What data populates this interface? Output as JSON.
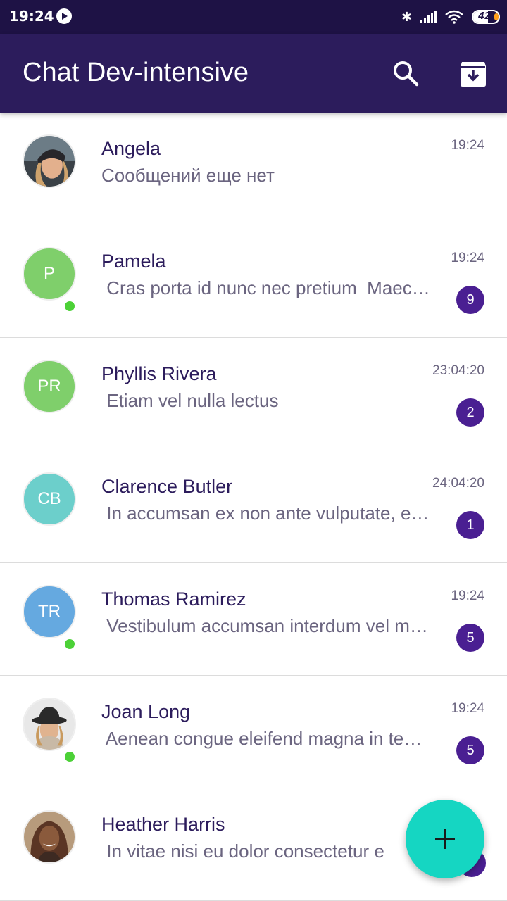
{
  "status_bar": {
    "time": "19:24",
    "battery": "42"
  },
  "app_bar": {
    "title": "Chat Dev-intensive"
  },
  "colors": {
    "primary": "#2c1c5c",
    "status_bar": "#1e1245",
    "accent": "#15d6c2",
    "badge": "#4a1f92",
    "online": "#4cd137"
  },
  "chats": [
    {
      "name": "Angela",
      "message": "Сообщений еще нет",
      "time": "19:24"
    },
    {
      "name": "Pamela",
      "message": " Cras porta id nunc nec pretium  Maecenas",
      "time": "19:24",
      "unread": "9",
      "initials": "P",
      "avatar_color": "#7fcf6b"
    },
    {
      "name": "Phyllis Rivera",
      "message": " Etiam vel nulla lectus",
      "time": "23:04:20",
      "unread": "2",
      "initials": "PR",
      "avatar_color": "#7fcf6b"
    },
    {
      "name": "Clarence Butler",
      "message": " In accumsan ex non ante vulputate, eget",
      "time": "24:04:20",
      "unread": "1",
      "initials": "CB",
      "avatar_color": "#6ccfcb"
    },
    {
      "name": "Thomas Ramirez",
      "message": " Vestibulum accumsan interdum vel metus",
      "time": "19:24",
      "unread": "5",
      "initials": "TR",
      "avatar_color": "#65a9e0"
    },
    {
      "name": "Joan Long",
      "message": " Aenean congue eleifend magna in tempus",
      "time": "19:24",
      "unread": "5"
    },
    {
      "name": "Heather Harris",
      "message": " In vitae nisi eu dolor consectetur e"
    }
  ]
}
